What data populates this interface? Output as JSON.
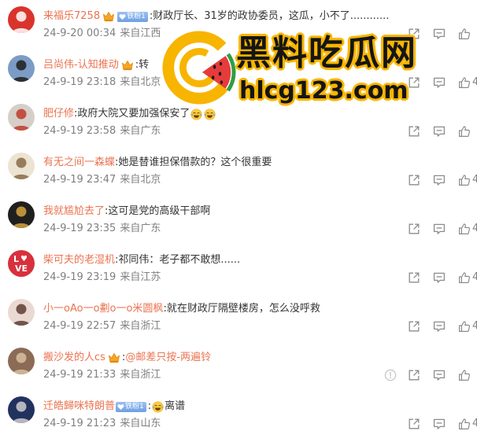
{
  "watermark": {
    "title": "黑料吃瓜网",
    "url": "hlcg123.com",
    "logo_icon": "watermelon-c-logo-icon"
  },
  "colors": {
    "username": "#eb7350",
    "text": "#333333",
    "meta": "#808080",
    "icon": "#8c8c8c",
    "badge": "#6f9fe3",
    "crown": "#f6a623",
    "watermark_yellow": "#f7b500",
    "watermark_text": "#151515"
  },
  "actions": [
    "share-icon",
    "comment-icon",
    "like-icon"
  ],
  "comments": [
    {
      "user": "来福乐7258",
      "crown": "crown-icon",
      "badge": "铁粉1",
      "content": [
        {
          "text": ":财政厅长、31岁的政协委员，这瓜，小不了............"
        }
      ],
      "time": "24-9-20 00:34",
      "location": "来自江西",
      "avatar": {
        "bg": "#d9342b",
        "fg": "#ffffff"
      }
    },
    {
      "user": "吕尚伟-认知推动",
      "crown": "crown-icon",
      "content": [
        {
          "text": ":转"
        }
      ],
      "time": "24-9-19 23:18",
      "location": "来自北京",
      "likes": "4",
      "avatar": {
        "bg": "#7b9cc4",
        "fg": "#1d1d1d"
      }
    },
    {
      "user": "肥仔修",
      "content": [
        {
          "text": ":政府大院又要加强保安了"
        },
        {
          "emoji": "laugh-cry-emoji-icon"
        },
        {
          "emoji": "laugh-cry-emoji-icon"
        }
      ],
      "time": "24-9-19 23:58",
      "location": "来自广东",
      "avatar": {
        "bg": "#d6cec8",
        "fg": "#c0392b"
      }
    },
    {
      "user": "有无之间一森蝶",
      "content": [
        {
          "text": ":她是替谁担保借款的？这个很重要"
        }
      ],
      "time": "24-9-19 23:47",
      "location": "来自北京",
      "likes": "4",
      "avatar": {
        "bg": "#ece3d2",
        "fg": "#8a6a44"
      }
    },
    {
      "user": "我就尴尬去了",
      "content": [
        {
          "text": ":这可是党的高级干部啊"
        }
      ],
      "time": "24-9-19 23:35",
      "location": "来自广东",
      "likes": "4",
      "avatar": {
        "bg": "#1f1f1f",
        "fg": "#d6a33d"
      }
    },
    {
      "user": "柴可夫的老湿机",
      "content": [
        {
          "text": ":祁同伟：老子都不敢想......"
        }
      ],
      "time": "24-9-19 23:19",
      "location": "来自江苏",
      "likes": "4",
      "avatar": {
        "bg": "#d8303c",
        "fg": "#ffffff"
      },
      "avatar_text": [
        "L",
        "VE"
      ]
    },
    {
      "user": "小一oAo一o劃o一o米圆枫",
      "content": [
        {
          "text": ":就在财政厅隔壁楼房，怎么没呼救"
        }
      ],
      "time": "24-9-19 22:57",
      "location": "来自浙江",
      "likes": "4",
      "avatar": {
        "bg": "#ead9d2",
        "fg": "#5c3d31"
      }
    },
    {
      "user": "搬沙发的人cs",
      "crown": "crown-icon",
      "content": [
        {
          "text": ":"
        },
        {
          "mention": "@邮差只按-两遍铃"
        }
      ],
      "time": "24-9-19 21:33",
      "location": "来自浙江",
      "report": "report-icon",
      "avatar": {
        "bg": "#8b6b56",
        "fg": "#d8bf9f"
      }
    },
    {
      "user": "迁皓歸咪特朗普",
      "badge": "铁粉1",
      "content": [
        {
          "text": ":"
        },
        {
          "emoji": "laugh-cry-emoji-icon"
        },
        {
          "text": "离谱"
        }
      ],
      "time": "24-9-19 21:23",
      "location": "来自山东",
      "likes": "4",
      "avatar": {
        "bg": "#22325f",
        "fg": "#cfcfcf"
      }
    }
  ]
}
